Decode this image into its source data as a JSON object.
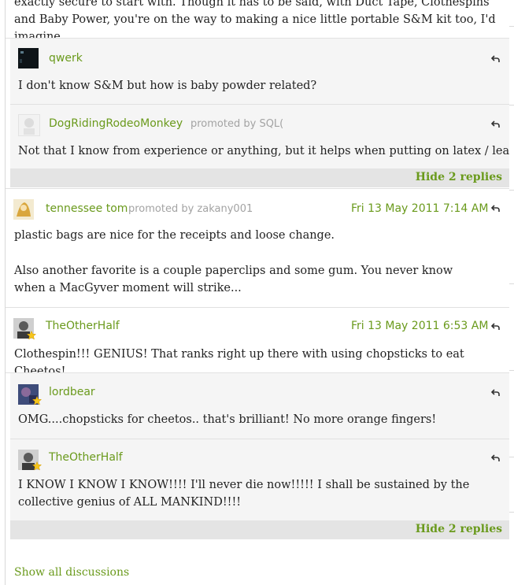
{
  "intro": {
    "text": "exactly secure to start with. Though it has to be said, with Duct Tape, Clothespins and Baby Power, you're on the way to making a nice little portable S&M kit too, I'd imagine."
  },
  "comments": {
    "qwerk": {
      "user": "qwerk",
      "text": "I don't know S&M but how is baby powder related?"
    },
    "dog": {
      "user": "DogRidingRodeoMonkey",
      "promoted": "promoted by SQL(",
      "text": "Not that I know from experience or anything, but it helps when putting on latex / leather."
    },
    "tom": {
      "user": "tennessee tom",
      "promoted": "promoted by zakany001",
      "date": "Fri 13 May 2011 7:14 AM",
      "text1": "plastic bags are nice for the receipts and loose change.",
      "text2": "Also another favorite is a couple paperclips and some gum. You never know when a MacGyver moment will strike..."
    },
    "half1": {
      "user": "TheOtherHalf",
      "date": "Fri 13 May 2011 6:53 AM",
      "text": "Clothespin!!! GENIUS! That ranks right up there with using chopsticks to eat Cheetos!"
    },
    "lordbear": {
      "user": "lordbear",
      "text": "OMG....chopsticks for cheetos.. that's brilliant! No more orange fingers!"
    },
    "half2": {
      "user": "TheOtherHalf",
      "text": "I KNOW I KNOW I KNOW!!!! I'll never die now!!!!! I shall be sustained by the collective genius of ALL MANKIND!!!!"
    }
  },
  "hide_replies_1": "Hide 2 replies",
  "hide_replies_2": "Hide 2 replies",
  "show_all": "Show all discussions",
  "colors": {
    "accent": "#6a9a1c",
    "muted": "#a3a3a3",
    "reply_bg": "#f5f5f5",
    "hide_bar_bg": "#e4e4e4"
  },
  "icons": {
    "reply": "reply-arrow-icon",
    "star": "star-badge-icon"
  }
}
